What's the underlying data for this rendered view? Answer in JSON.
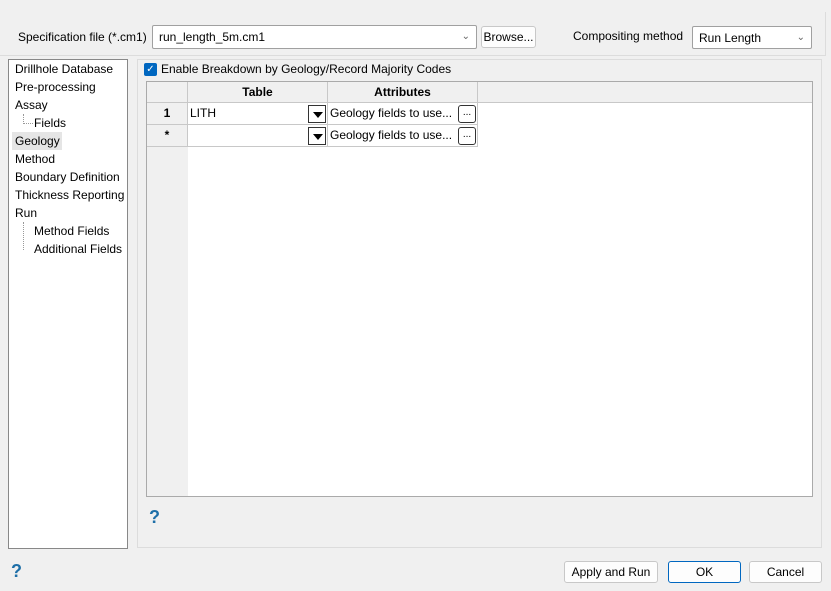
{
  "spec_file": {
    "label": "Specification file (*.cm1)",
    "value": "run_length_5m.cm1",
    "browse_label": "Browse..."
  },
  "compositing": {
    "label": "Compositing method",
    "value": "Run Length"
  },
  "tree": {
    "items": [
      {
        "label": "Drillhole Database"
      },
      {
        "label": "Pre-processing"
      },
      {
        "label": "Assay"
      },
      {
        "label": "Fields"
      },
      {
        "label": "Geology"
      },
      {
        "label": "Method"
      },
      {
        "label": "Boundary Definition"
      },
      {
        "label": "Thickness Reporting"
      },
      {
        "label": "Run"
      },
      {
        "label": "Method Fields"
      },
      {
        "label": "Additional Fields"
      }
    ],
    "selected": "Geology"
  },
  "geology": {
    "enable_label": "Enable Breakdown by Geology/Record Majority Codes",
    "enable_checked": true,
    "columns": [
      "Table",
      "Attributes"
    ],
    "rows": [
      {
        "header": "1",
        "table": "LITH",
        "attributes": "Geology fields to use..."
      },
      {
        "header": "*",
        "table": "",
        "attributes": "Geology fields to use..."
      }
    ],
    "ellipsis": "..."
  },
  "help_glyph": "?",
  "footer": {
    "apply_run": "Apply and Run",
    "ok": "OK",
    "cancel": "Cancel"
  },
  "colors": {
    "accent": "#0067c0",
    "help": "#1e6fa8"
  }
}
